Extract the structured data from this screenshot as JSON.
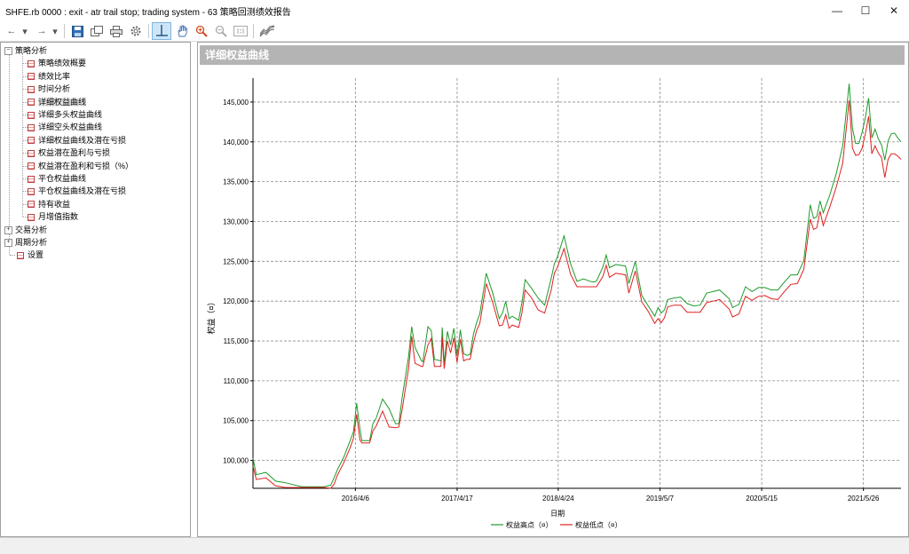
{
  "window": {
    "title": "SHFE.rb 0000 : exit - atr trail stop; trading system - 63 策略回测绩效报告",
    "minimize": "—",
    "maximize": "☐",
    "close": "✕"
  },
  "toolbar": {
    "back_icon": "←",
    "dropdown_icon": "▾",
    "forward_icon": "→",
    "active_tool": "crosshair-tool"
  },
  "tree": [
    {
      "label": "策略分析",
      "level": 0,
      "expander": "−"
    },
    {
      "label": "策略绩效概要",
      "level": 1
    },
    {
      "label": "绩效比率",
      "level": 1
    },
    {
      "label": "时间分析",
      "level": 1
    },
    {
      "label": "详细权益曲线",
      "level": 1,
      "selected": true
    },
    {
      "label": "详细多头权益曲线",
      "level": 1
    },
    {
      "label": "详细空头权益曲线",
      "level": 1
    },
    {
      "label": "详细权益曲线及潜在亏损",
      "level": 1
    },
    {
      "label": "权益潜在盈利与亏损",
      "level": 1
    },
    {
      "label": "权益潜在盈利和亏损（%）",
      "level": 1
    },
    {
      "label": "平仓权益曲线",
      "level": 1
    },
    {
      "label": "平仓权益曲线及潜在亏损",
      "level": 1
    },
    {
      "label": "持有收益",
      "level": 1
    },
    {
      "label": "月增值指数",
      "level": 1
    },
    {
      "label": "交易分析",
      "level": 0,
      "expander": "+"
    },
    {
      "label": "周期分析",
      "level": 0,
      "expander": "+"
    },
    {
      "label": "设置",
      "level": 0
    }
  ],
  "panel": {
    "header": "详细权益曲线"
  },
  "chart_data": {
    "type": "line",
    "ylabel": "权益（¤）",
    "xlabel": "日期",
    "ylim": [
      96500,
      148000
    ],
    "yticks": [
      "100,000",
      "105,000",
      "110,000",
      "115,000",
      "120,000",
      "125,000",
      "130,000",
      "135,000",
      "140,000",
      "145,000"
    ],
    "ytick_values": [
      100000,
      105000,
      110000,
      115000,
      120000,
      125000,
      130000,
      135000,
      140000,
      145000
    ],
    "xticks": [
      "2016/4/6",
      "2017/4/17",
      "2018/4/24",
      "2019/5/7",
      "2020/5/15",
      "2021/5/26"
    ],
    "xtick_values": [
      0.158,
      0.315,
      0.471,
      0.628,
      0.785,
      0.942
    ],
    "grid": true,
    "legend_position": "bottom",
    "colors": {
      "high": "#1f9a2a",
      "low": "#e02020"
    },
    "series": [
      {
        "name": "权益高点（¤）",
        "color": "#1f9a2a"
      },
      {
        "name": "权益低点（¤）",
        "color": "#e02020"
      }
    ],
    "x": [
      0,
      0.005,
      0.02,
      0.035,
      0.05,
      0.075,
      0.09,
      0.11,
      0.12,
      0.125,
      0.13,
      0.14,
      0.15,
      0.155,
      0.16,
      0.165,
      0.168,
      0.172,
      0.18,
      0.185,
      0.19,
      0.2,
      0.21,
      0.22,
      0.225,
      0.23,
      0.24,
      0.245,
      0.25,
      0.26,
      0.262,
      0.27,
      0.275,
      0.28,
      0.29,
      0.292,
      0.295,
      0.3,
      0.305,
      0.31,
      0.315,
      0.32,
      0.325,
      0.33,
      0.335,
      0.34,
      0.345,
      0.35,
      0.36,
      0.37,
      0.38,
      0.385,
      0.39,
      0.395,
      0.4,
      0.41,
      0.415,
      0.42,
      0.43,
      0.44,
      0.45,
      0.46,
      0.465,
      0.47,
      0.48,
      0.49,
      0.5,
      0.51,
      0.52,
      0.525,
      0.53,
      0.54,
      0.545,
      0.55,
      0.56,
      0.575,
      0.58,
      0.59,
      0.6,
      0.61,
      0.62,
      0.625,
      0.63,
      0.635,
      0.64,
      0.65,
      0.66,
      0.67,
      0.68,
      0.69,
      0.7,
      0.71,
      0.72,
      0.735,
      0.74,
      0.75,
      0.76,
      0.77,
      0.78,
      0.79,
      0.8,
      0.81,
      0.82,
      0.83,
      0.84,
      0.85,
      0.86,
      0.865,
      0.87,
      0.875,
      0.88,
      0.89,
      0.9,
      0.91,
      0.92,
      0.925,
      0.93,
      0.935,
      0.94,
      0.945,
      0.95,
      0.955,
      0.96,
      0.965,
      0.97,
      0.975,
      0.98,
      0.985,
      0.99,
      0.995,
      1.0
    ],
    "values_high": [
      100300,
      98200,
      98500,
      97400,
      97200,
      96700,
      96700,
      96700,
      96900,
      97800,
      98800,
      100400,
      102500,
      103600,
      107200,
      104000,
      102500,
      102500,
      102500,
      104600,
      105300,
      107700,
      106500,
      104600,
      104600,
      107800,
      113000,
      116800,
      114200,
      112500,
      112400,
      116800,
      116300,
      112700,
      112500,
      116700,
      112100,
      116200,
      114500,
      116600,
      113200,
      116400,
      113400,
      113200,
      113300,
      115800,
      117300,
      118400,
      123500,
      121000,
      117800,
      118500,
      120000,
      117800,
      118100,
      117600,
      119800,
      122700,
      121600,
      120400,
      119500,
      122800,
      124700,
      125600,
      128200,
      124700,
      122500,
      122800,
      122500,
      122400,
      122500,
      124300,
      125800,
      124200,
      124600,
      124400,
      122200,
      125000,
      120700,
      119400,
      118100,
      119200,
      118500,
      118900,
      120200,
      120400,
      120500,
      119700,
      119400,
      119500,
      121000,
      121200,
      121400,
      120300,
      119200,
      119600,
      121800,
      121200,
      121700,
      121700,
      121400,
      121400,
      122400,
      123300,
      123300,
      125100,
      132100,
      130400,
      130600,
      132600,
      131100,
      133300,
      136000,
      139500,
      147300,
      141700,
      139800,
      139800,
      141200,
      143000,
      145500,
      140500,
      141600,
      140400,
      139600,
      137700,
      140100,
      141000,
      141100,
      140500,
      140000
    ],
    "values_low": [
      99300,
      97600,
      97800,
      96800,
      96600,
      96600,
      96600,
      96600,
      96500,
      97000,
      98100,
      99700,
      101600,
      102800,
      105800,
      102600,
      102200,
      102200,
      102200,
      103700,
      104300,
      106200,
      104200,
      104100,
      104200,
      106300,
      111500,
      115600,
      112200,
      111800,
      111800,
      114500,
      115300,
      111800,
      111800,
      115500,
      111500,
      115000,
      113500,
      115400,
      112300,
      115200,
      112500,
      112700,
      112700,
      114700,
      116300,
      117200,
      122200,
      119800,
      116900,
      117000,
      118300,
      116600,
      117000,
      116700,
      118500,
      121400,
      120400,
      118900,
      118500,
      121300,
      123500,
      124300,
      126600,
      123400,
      121800,
      121800,
      121800,
      121800,
      121800,
      123100,
      124500,
      123000,
      123500,
      123300,
      121000,
      123800,
      119900,
      118700,
      117200,
      117800,
      117300,
      117900,
      119300,
      119500,
      119500,
      118600,
      118600,
      118600,
      119800,
      120000,
      120200,
      119000,
      118000,
      118400,
      120600,
      120100,
      120600,
      120700,
      120300,
      120200,
      121200,
      122100,
      122200,
      124000,
      130300,
      129000,
      129200,
      131300,
      129500,
      131800,
      134300,
      137300,
      145200,
      139200,
      138300,
      138400,
      139200,
      141000,
      143200,
      138500,
      139500,
      138600,
      138000,
      135500,
      137800,
      138500,
      138500,
      138200,
      137800
    ]
  }
}
